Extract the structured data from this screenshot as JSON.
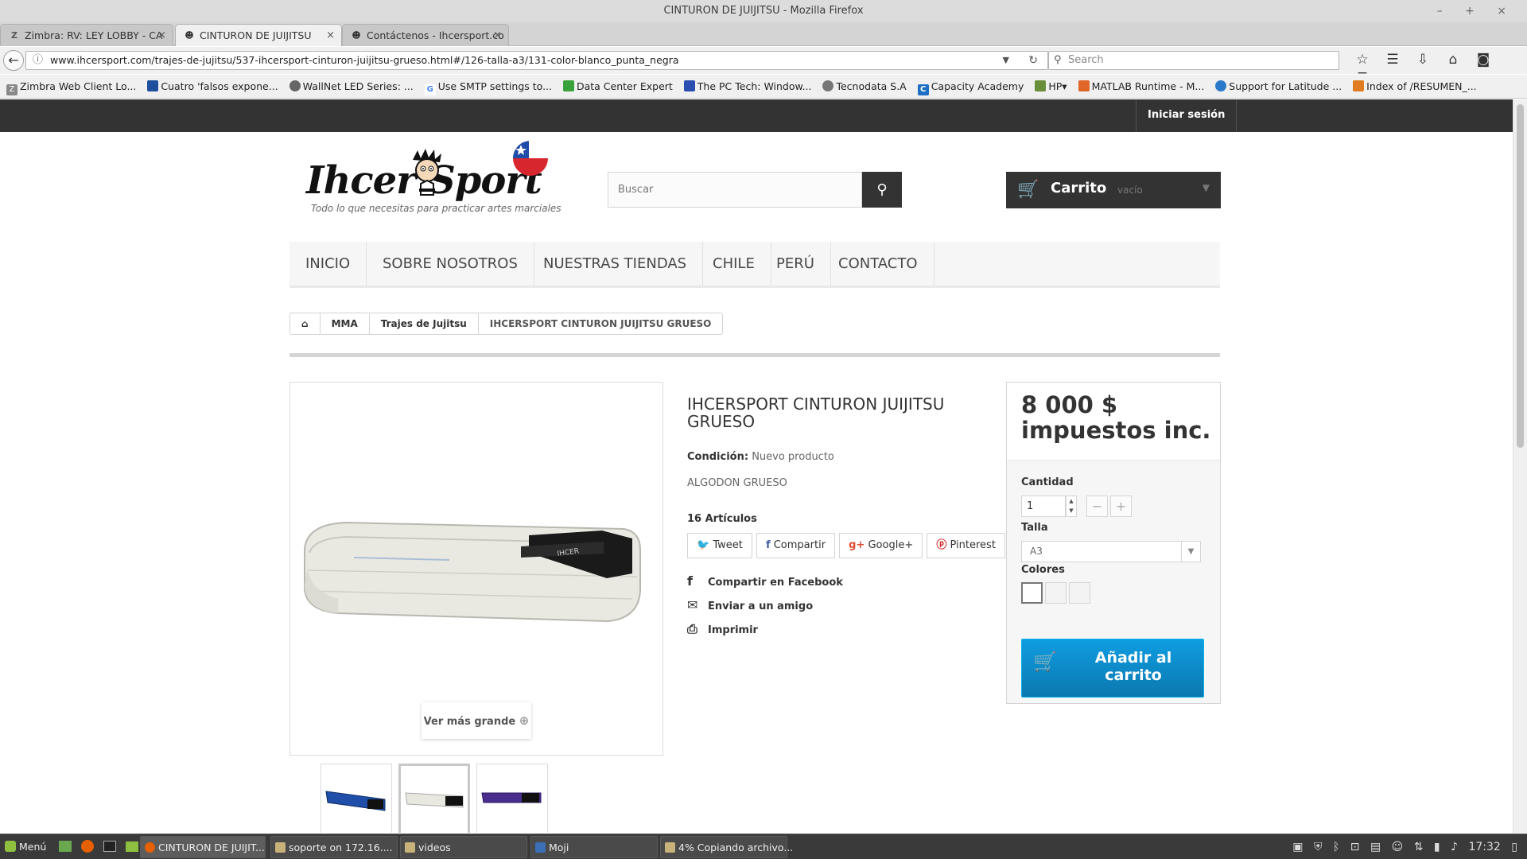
{
  "window": {
    "title": "CINTURON DE JUIJITSU - Mozilla Firefox",
    "controls": "– + ×"
  },
  "tabs": [
    {
      "label": "Zimbra: RV: LEY LOBBY - CA",
      "icon": "zimbra-icon"
    },
    {
      "label": "CINTURON DE JUIJITSU",
      "icon": "ihcersport-icon"
    },
    {
      "label": "Contáctenos - Ihcersport.co",
      "icon": "ihcersport-icon"
    }
  ],
  "toolbar": {
    "url": "www.ihcersport.com/trajes-de-jujitsu/537-ihcersport-cinturon-juijitsu-grueso.html#/126-talla-a3/131-color-blanco_punta_negra",
    "search_placeholder": "Search"
  },
  "bookmarks": [
    {
      "label": "Zimbra Web Client Lo...",
      "color": "#888888",
      "glyph": "Z"
    },
    {
      "label": "Cuatro 'falsos expone...",
      "color": "#1d4f9c",
      "glyph": ""
    },
    {
      "label": "WallNet LED Series: ...",
      "color": "#666666",
      "glyph": ""
    },
    {
      "label": "Use SMTP settings to...",
      "color": "#4285f4",
      "glyph": "G"
    },
    {
      "label": "Data Center Expert",
      "color": "#3aa23a",
      "glyph": ""
    },
    {
      "label": "The PC Tech: Window...",
      "color": "#2a4fb0",
      "glyph": ""
    },
    {
      "label": "Tecnodata S.A",
      "color": "#777777",
      "glyph": ""
    },
    {
      "label": "Capacity Academy",
      "color": "#1e6fc4",
      "glyph": "C"
    },
    {
      "label": "HP",
      "color": "#6a8f3a",
      "glyph": ""
    },
    {
      "label": "MATLAB Runtime - M...",
      "color": "#e0662a",
      "glyph": ""
    },
    {
      "label": "Support for Latitude ...",
      "color": "#2b79c9",
      "glyph": ""
    },
    {
      "label": "Index of /RESUMEN_...",
      "color": "#e07b20",
      "glyph": ""
    }
  ],
  "site": {
    "login": "Iniciar sesión",
    "logo_text": "Ihcer Sport",
    "logo_sub": "Todo lo que necesitas para practicar artes marciales",
    "search_placeholder": "Buscar",
    "cart_label": "Carrito",
    "cart_status": "vacío",
    "menu": [
      "INICIO",
      "SOBRE NOSOTROS",
      "NUESTRAS TIENDAS",
      "CHILE",
      "PERÚ",
      "CONTACTO"
    ],
    "breadcrumb": [
      "MMA",
      "Trajes de Jujitsu",
      "IHCERSPORT CINTURON JUIJITSU GRUESO"
    ]
  },
  "product": {
    "title": "IHCERSPORT CINTURON JUIJITSU GRUESO",
    "condition_label": "Condición:",
    "condition_value": "Nuevo producto",
    "description": "ALGODON GRUESO",
    "quantity_text": "16 Artículos",
    "share_buttons": [
      "Tweet",
      "Compartir",
      "Google+",
      "Pinterest"
    ],
    "links": [
      "Compartir en Facebook",
      "Enviar a un amigo",
      "Imprimir"
    ],
    "view_larger": "Ver más grande",
    "price": "8 000 $ impuestos inc.",
    "qty_label": "Cantidad",
    "qty_value": "1",
    "size_label": "Talla",
    "size_value": "A3",
    "colors_label": "Colores",
    "add_to_cart": "Añadir al carrito"
  },
  "taskbar": {
    "menu": "Menú",
    "windows": [
      "CINTURON DE JUIJIT...",
      "soporte on 172.16....",
      "videos",
      "Moji",
      "4% Copiando archivo..."
    ],
    "clock": "17:32"
  }
}
